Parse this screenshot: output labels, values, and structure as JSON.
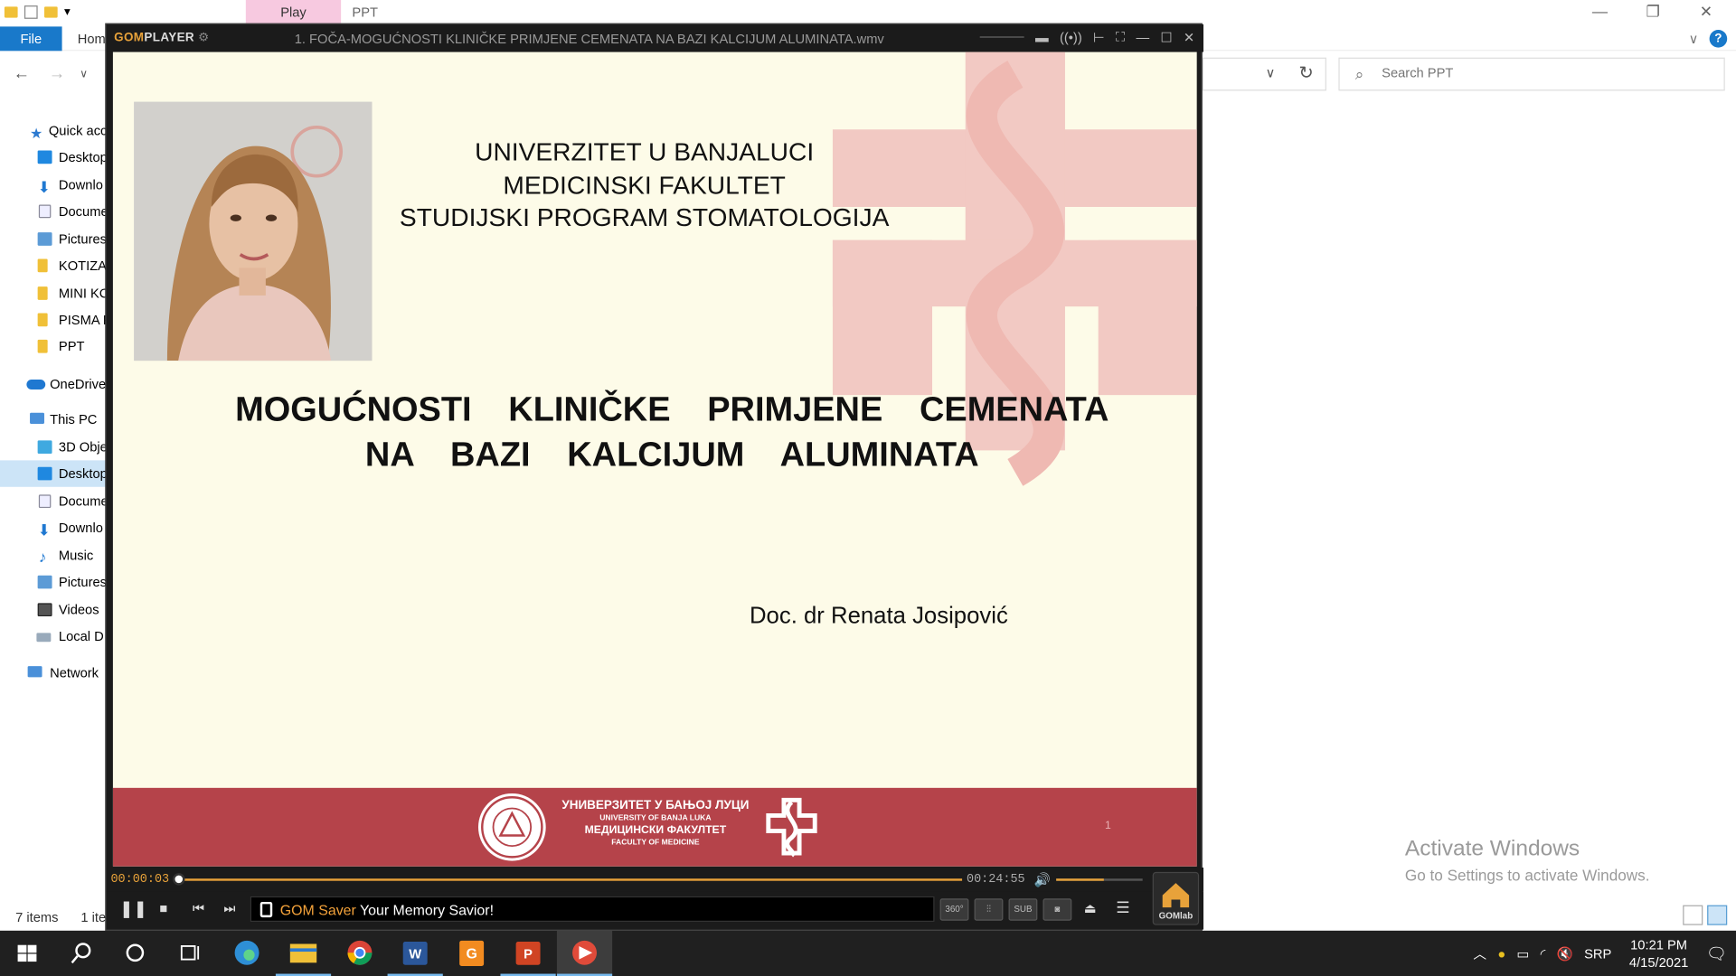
{
  "explorer": {
    "ribbon_context_tab": "Play",
    "window_title": "PPT",
    "file_tab": "File",
    "home_tab": "Hom",
    "search_placeholder": "Search PPT",
    "sidebar": [
      {
        "label": "Quick acc",
        "icon": "star-icon"
      },
      {
        "label": "Desktop",
        "icon": "desktop-icon"
      },
      {
        "label": "Downlo",
        "icon": "download-icon"
      },
      {
        "label": "Docume",
        "icon": "document-icon"
      },
      {
        "label": "Pictures",
        "icon": "pictures-icon"
      },
      {
        "label": "KOTIZA",
        "icon": "folder-icon"
      },
      {
        "label": "MINI KC",
        "icon": "folder-icon"
      },
      {
        "label": "PISMA F",
        "icon": "folder-icon"
      },
      {
        "label": "PPT",
        "icon": "folder-icon"
      },
      {
        "label": "OneDrive",
        "icon": "cloud-icon"
      },
      {
        "label": "This PC",
        "icon": "computer-icon"
      },
      {
        "label": "3D Obje",
        "icon": "cube-icon"
      },
      {
        "label": "Desktop",
        "icon": "desktop-icon"
      },
      {
        "label": "Docume",
        "icon": "document-icon"
      },
      {
        "label": "Downlo",
        "icon": "download-icon"
      },
      {
        "label": "Music",
        "icon": "music-icon"
      },
      {
        "label": "Pictures",
        "icon": "pictures-icon"
      },
      {
        "label": "Videos",
        "icon": "videos-icon"
      },
      {
        "label": "Local D",
        "icon": "drive-icon"
      },
      {
        "label": "Network",
        "icon": "network-icon"
      }
    ],
    "status_items": "7 items",
    "status_selected": "1 ite",
    "activate_title": "Activate Windows",
    "activate_sub": "Go to Settings to activate Windows."
  },
  "gom": {
    "logo_a": "GOM",
    "logo_b": "PLAYER",
    "title": "1. FOČA-MOGUĆNOSTI KLINIČKE PRIMJENE CEMENATA NA BAZI KALCIJUM ALUMINATA.wmv",
    "elapsed": "00:00:03",
    "total": "00:24:55",
    "progress_fraction": 0.002,
    "volume_fraction": 0.55,
    "marquee_brand": "GOM Saver",
    "marquee_text": " Your Memory Savior!",
    "btn_360": "360°",
    "btn_sub": "SUB",
    "gomlab": "GOMlab",
    "accent": "#e8a23a"
  },
  "slide": {
    "uni_line1": "UNIVERZITET U BANJALUCI",
    "uni_line2": "MEDICINSKI FAKULTET",
    "uni_line3": "STUDIJSKI PROGRAM STOMATOLOGIJA",
    "title_line1": "MOGUĆNOSTI  KLINIČKE  PRIMJENE  CEMENATA",
    "title_line2": "NA  BAZI  KALCIJUM  ALUMINATA",
    "author": "Doc. dr Renata Josipović",
    "footer_1": "УНИВЕРЗИТЕТ У БАЊОЈ ЛУЦИ",
    "footer_2": "UNIVERSITY OF BANJA LUKA",
    "footer_3": "МЕДИЦИНСКИ ФАКУЛТЕТ",
    "footer_4": "FACULTY OF MEDICINE",
    "page_number": "1",
    "footer_color": "#b5434a"
  },
  "taskbar": {
    "language": "SRP",
    "time": "10:21 PM",
    "date": "4/15/2021"
  }
}
